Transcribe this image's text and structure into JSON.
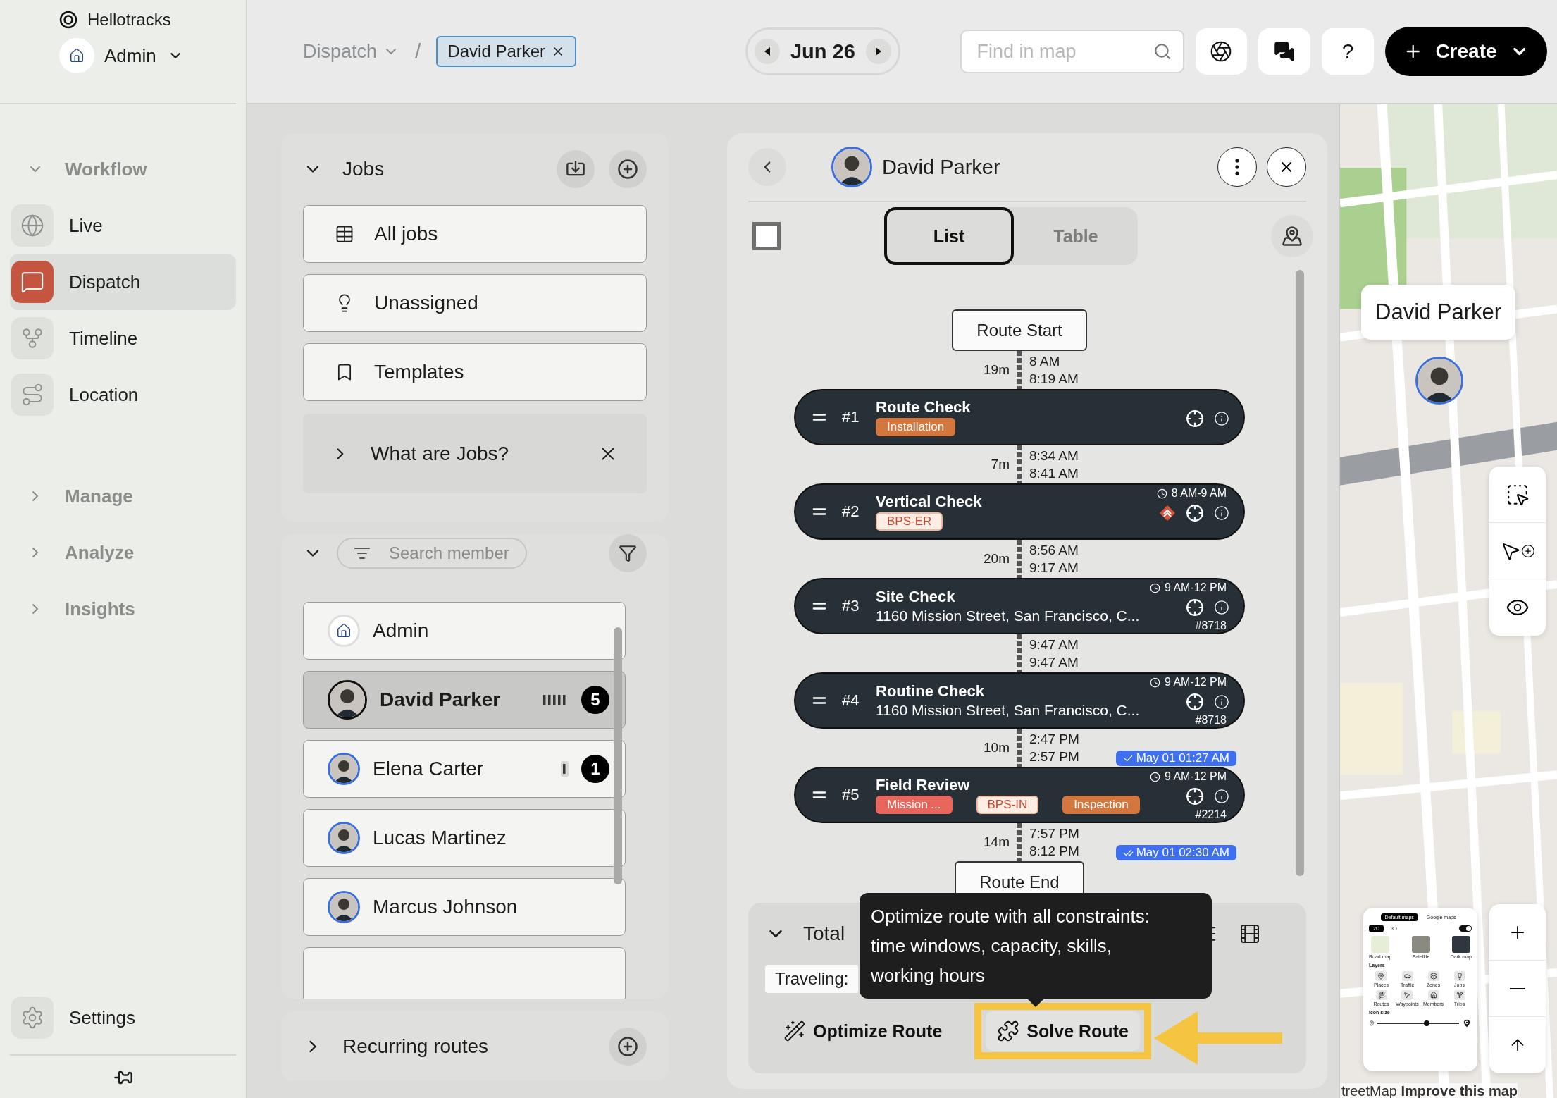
{
  "sidebar": {
    "brand": "Hellotracks",
    "account": "Admin",
    "nav": [
      {
        "kind": "section",
        "label": "Workflow",
        "expanded": true
      },
      {
        "kind": "item",
        "label": "Live",
        "selected": false
      },
      {
        "kind": "item",
        "label": "Dispatch",
        "selected": true
      },
      {
        "kind": "item",
        "label": "Timeline",
        "selected": false
      },
      {
        "kind": "item",
        "label": "Location",
        "selected": false
      },
      {
        "kind": "section",
        "label": "Manage",
        "expanded": false
      },
      {
        "kind": "section",
        "label": "Analyze",
        "expanded": false
      },
      {
        "kind": "section",
        "label": "Insights",
        "expanded": false
      }
    ],
    "settings": "Settings"
  },
  "topbar": {
    "breadcrumb": "Dispatch",
    "separator": "/",
    "filter_chip": "David Parker",
    "date": "Jun 26",
    "search": {
      "placeholder": "Find in map"
    },
    "help": "?",
    "create": "Create"
  },
  "jobs": {
    "title": "Jobs",
    "expanded": true,
    "views": [
      "All jobs",
      "Unassigned",
      "Templates"
    ],
    "help": {
      "label": "What are Jobs?",
      "expanded": false
    }
  },
  "members": {
    "expanded": true,
    "search": {
      "placeholder": "Search member"
    },
    "items": [
      {
        "kind": "company",
        "name": "Admin",
        "selected": false
      },
      {
        "kind": "person",
        "name": "David Parker",
        "selected": true,
        "count": "5"
      },
      {
        "kind": "person",
        "name": "Elena Carter",
        "selected": false,
        "count": "1"
      },
      {
        "kind": "person",
        "name": "Lucas Martinez",
        "selected": false
      },
      {
        "kind": "person",
        "name": "Marcus Johnson",
        "selected": false
      }
    ]
  },
  "recurring": {
    "title": "Recurring routes",
    "expanded": false
  },
  "route": {
    "member": "David Parker",
    "select_all": {
      "checked": false
    },
    "tabs": [
      {
        "label": "List",
        "selected": true
      },
      {
        "label": "Table",
        "selected": false
      }
    ],
    "start": "Route Start",
    "end": "Route End",
    "items": [
      {
        "kind": "leg",
        "duration": "19m",
        "arrive": "8 AM",
        "depart": "8:19 AM"
      },
      {
        "kind": "stop",
        "number": "#1",
        "title": "Route Check",
        "tags": [
          {
            "label": "Installation",
            "kind": "filled",
            "color": "#d4773e"
          }
        ],
        "warning": false
      },
      {
        "kind": "leg",
        "duration": "7m",
        "arrive": "8:34 AM",
        "depart": "8:41 AM"
      },
      {
        "kind": "stop",
        "number": "#2",
        "title": "Vertical Check",
        "tags": [
          {
            "label": "BPS-ER",
            "kind": "outline",
            "color": "#c9472c"
          }
        ],
        "window": "8 AM-9 AM",
        "warning": true
      },
      {
        "kind": "leg",
        "duration": "20m",
        "arrive": "8:56 AM",
        "depart": "9:17 AM"
      },
      {
        "kind": "stop",
        "number": "#3",
        "title": "Site Check",
        "address": "1160 Mission Street, San Francisco, C...",
        "window": "9 AM-12 PM",
        "ref": "#8718",
        "warning": false
      },
      {
        "kind": "leg",
        "arrive": "9:47 AM",
        "depart": "9:47 AM"
      },
      {
        "kind": "stop",
        "number": "#4",
        "title": "Routine Check",
        "address": "1160 Mission Street, San Francisco, C...",
        "window": "9 AM-12 PM",
        "ref": "#8718",
        "warning": false
      },
      {
        "kind": "leg",
        "duration": "10m",
        "arrive": "2:47 PM",
        "depart": "2:57 PM",
        "sync": {
          "kind": "sent",
          "label": "May 01 01:27 AM"
        }
      },
      {
        "kind": "stop",
        "number": "#5",
        "title": "Field Review",
        "tags": [
          {
            "label": "Mission ...",
            "kind": "filled",
            "color": "#e8665c"
          },
          {
            "label": "BPS-IN",
            "kind": "outline",
            "color": "#c9472c"
          },
          {
            "label": "Inspection",
            "kind": "filled",
            "color": "#d4773e"
          }
        ],
        "window": "9 AM-12 PM",
        "ref": "#2214",
        "warning": false
      },
      {
        "kind": "leg",
        "duration": "14m",
        "arrive": "7:57 PM",
        "depart": "8:12 PM",
        "sync": {
          "kind": "read",
          "label": "May 01 02:30 AM"
        }
      }
    ]
  },
  "summary": {
    "expanded": true,
    "total": "Total",
    "traveling": "Traveling:",
    "actions": [
      {
        "kind": "optimize",
        "label": "Optimize Route",
        "highlighted": false
      },
      {
        "kind": "solve",
        "label": "Solve Route",
        "highlighted": true
      }
    ]
  },
  "tooltip": "Optimize route with all constraints: time windows, capacity, skills, working hours",
  "map": {
    "callout": "David Parker",
    "layers_panel": {
      "sources": [
        {
          "label": "Default maps",
          "selected": true
        },
        {
          "label": "Google maps",
          "selected": false
        }
      ],
      "modes": [
        {
          "label": "2D",
          "selected": true
        },
        {
          "label": "3D",
          "selected": false
        }
      ],
      "toggle": {
        "on": true
      },
      "styles": [
        "Road map",
        "Satellite",
        "Dark map"
      ],
      "title": "Layers",
      "layers": [
        "Places",
        "Traffic",
        "Zones",
        "Jobs",
        "Routes",
        "Waypoints",
        "Members",
        "Trips"
      ],
      "icon_size": {
        "label": "Icon size",
        "level": 0.6
      }
    },
    "attribution": "treetMap **Improve this map**"
  }
}
